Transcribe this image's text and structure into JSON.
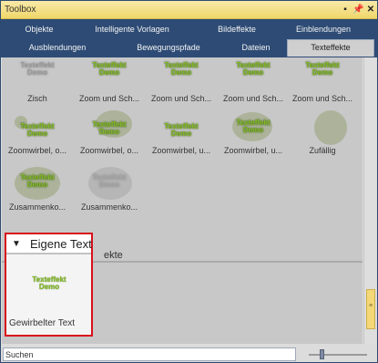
{
  "window": {
    "title": "Toolbox"
  },
  "title_buttons": [
    "▪",
    "📌",
    "✕"
  ],
  "tabs_row1": [
    "Objekte",
    "Intelligente Vorlagen",
    "Bildeffekte",
    "Einblendungen"
  ],
  "tabs_row2": [
    "Ausblendungen",
    "Bewegungspfade",
    "Dateien",
    "Texteffekte"
  ],
  "thumb_text": "Texteffekt\nDemo",
  "items": [
    "Zisch",
    "Zoom und Sch...",
    "Zoom und Sch...",
    "Zoom und Sch...",
    "Zoom und Sch...",
    "Zoomwirbel, o...",
    "Zoomwirbel, o...",
    "Zoomwirbel, u...",
    "Zoomwirbel, u...",
    "Zufällig",
    "Zusammenko...",
    "Zusammenko..."
  ],
  "section_label": "ekte",
  "highlight": {
    "title": "Eigene Texte",
    "item_label": "Gewirbelter Text"
  },
  "search": {
    "value": "Suchen"
  },
  "colors": {
    "tab_bar": "#2d4b75",
    "titlebar": "#f0d76b",
    "highlight_border": "#d8101a",
    "thumb_text": "#8bbd2a"
  }
}
